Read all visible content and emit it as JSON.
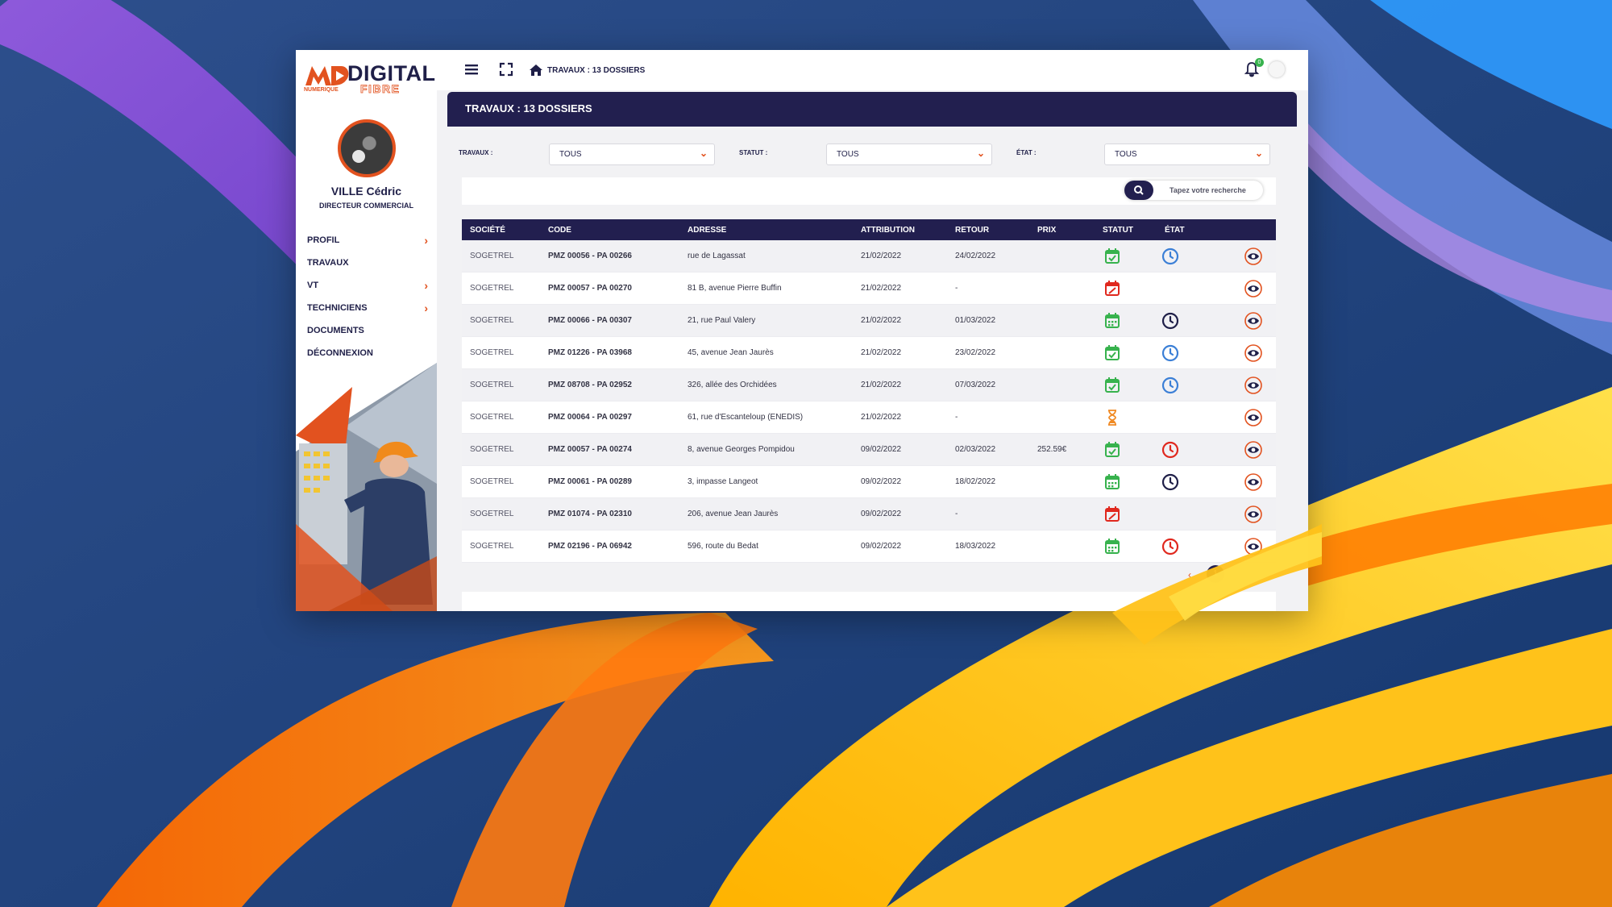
{
  "colors": {
    "navy": "#221f4f",
    "accent": "#e2521f",
    "ok": "#37b24d",
    "clock_blue": "#3b7fd6",
    "clock_dark": "#1f1f48",
    "clock_red": "#e0281e",
    "hourglass": "#f08a24"
  },
  "logo": {
    "word1": "DIGITAL",
    "word2": "FIBRE",
    "word3": "NUMERIQUE"
  },
  "user": {
    "name": "VILLE Cédric",
    "role": "DIRECTEUR COMMERCIAL"
  },
  "nav": [
    {
      "label": "PROFIL",
      "chevron": true
    },
    {
      "label": "TRAVAUX",
      "chevron": false
    },
    {
      "label": "VT",
      "chevron": true
    },
    {
      "label": "TECHNICIENS",
      "chevron": true
    },
    {
      "label": "DOCUMENTS",
      "chevron": false
    },
    {
      "label": "DÉCONNEXION",
      "chevron": false
    }
  ],
  "topbar": {
    "breadcrumb": "TRAVAUX : 13 DOSSIERS",
    "notifications": "0"
  },
  "card": {
    "title": "TRAVAUX : 13 DOSSIERS"
  },
  "filters": {
    "travaux": {
      "label": "TRAVAUX :",
      "value": "TOUS"
    },
    "statut": {
      "label": "STATUT :",
      "value": "TOUS"
    },
    "etat": {
      "label": "ÉTAT :",
      "value": "TOUS"
    }
  },
  "search": {
    "placeholder": "Tapez votre recherche"
  },
  "table": {
    "columns": [
      "SOCIÉTÉ",
      "CODE",
      "ADRESSE",
      "ATTRIBUTION",
      "RETOUR",
      "PRIX",
      "STATUT",
      "ÉTAT"
    ],
    "rows": [
      {
        "societe": "SOGETREL",
        "code": "PMZ 00056 - PA 00266",
        "adresse": "rue de Lagassat",
        "attribution": "21/02/2022",
        "retour": "24/02/2022",
        "prix": "",
        "statut": "calendar-check",
        "etat": "clock-blue"
      },
      {
        "societe": "SOGETREL",
        "code": "PMZ 00057 - PA 00270",
        "adresse": "81 B, avenue Pierre Buffin",
        "attribution": "21/02/2022",
        "retour": "-",
        "prix": "",
        "statut": "calendar-cancel",
        "etat": ""
      },
      {
        "societe": "SOGETREL",
        "code": "PMZ 00066 - PA 00307",
        "adresse": "21, rue Paul Valery",
        "attribution": "21/02/2022",
        "retour": "01/03/2022",
        "prix": "",
        "statut": "calendar-dots",
        "etat": "clock-dark"
      },
      {
        "societe": "SOGETREL",
        "code": "PMZ 01226 - PA 03968",
        "adresse": "45, avenue Jean Jaurès",
        "attribution": "21/02/2022",
        "retour": "23/02/2022",
        "prix": "",
        "statut": "calendar-check",
        "etat": "clock-blue"
      },
      {
        "societe": "SOGETREL",
        "code": "PMZ 08708 - PA 02952",
        "adresse": "326, allée des Orchidées",
        "attribution": "21/02/2022",
        "retour": "07/03/2022",
        "prix": "",
        "statut": "calendar-check",
        "etat": "clock-blue"
      },
      {
        "societe": "SOGETREL",
        "code": "PMZ 00064 - PA 00297",
        "adresse": "61, rue d'Escanteloup (ENEDIS)",
        "attribution": "21/02/2022",
        "retour": "-",
        "prix": "",
        "statut": "hourglass",
        "etat": ""
      },
      {
        "societe": "SOGETREL",
        "code": "PMZ 00057 - PA 00274",
        "adresse": "8, avenue Georges Pompidou",
        "attribution": "09/02/2022",
        "retour": "02/03/2022",
        "prix": "252.59€",
        "statut": "calendar-check",
        "etat": "clock-red"
      },
      {
        "societe": "SOGETREL",
        "code": "PMZ 00061 - PA 00289",
        "adresse": "3, impasse Langeot",
        "attribution": "09/02/2022",
        "retour": "18/02/2022",
        "prix": "",
        "statut": "calendar-dots",
        "etat": "clock-dark"
      },
      {
        "societe": "SOGETREL",
        "code": "PMZ 01074 - PA 02310",
        "adresse": "206, avenue Jean Jaurès",
        "attribution": "09/02/2022",
        "retour": "-",
        "prix": "",
        "statut": "calendar-cancel",
        "etat": ""
      },
      {
        "societe": "SOGETREL",
        "code": "PMZ 02196 - PA 06942",
        "adresse": "596, route du Bedat",
        "attribution": "09/02/2022",
        "retour": "18/03/2022",
        "prix": "",
        "statut": "calendar-dots",
        "etat": "clock-red"
      }
    ]
  },
  "pagination": {
    "prev": "‹",
    "current": "1"
  }
}
